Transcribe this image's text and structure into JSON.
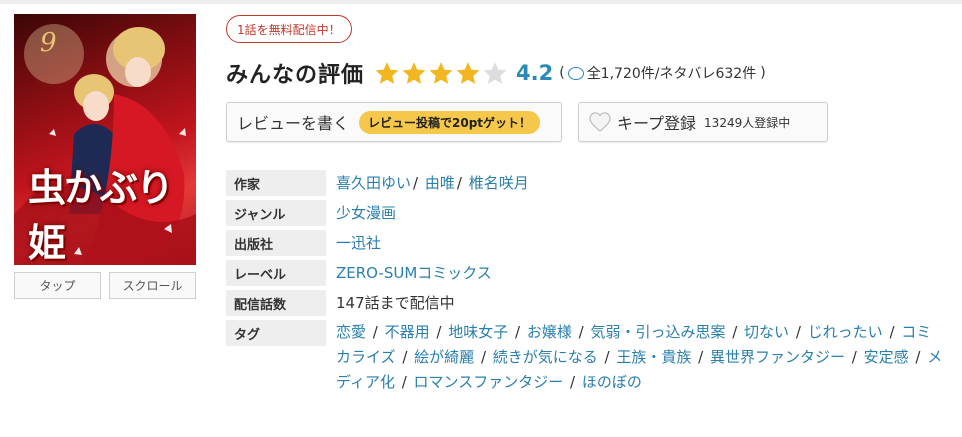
{
  "cover": {
    "title_text": "虫かぶり姫",
    "volume_mark": "9",
    "buttons": [
      {
        "label": "タップ"
      },
      {
        "label": "スクロール"
      }
    ]
  },
  "free_badge": "1話を無料配信中！",
  "rating": {
    "heading": "みんなの評価",
    "score": "4.2",
    "stars_filled": 4,
    "stars_total": 5,
    "counts_open": "(",
    "counts_text": "全1,720件/ネタバレ632件",
    "counts_close": ")"
  },
  "review_button": {
    "label": "レビューを書く",
    "bonus": "レビュー投稿で20ptゲット！"
  },
  "keep_button": {
    "label": "キープ登録",
    "count": "13249人登録中"
  },
  "info": {
    "author_key": "作家",
    "authors": [
      "喜久田ゆい",
      "由唯",
      "椎名咲月"
    ],
    "genre_key": "ジャンル",
    "genre": "少女漫画",
    "publisher_key": "出版社",
    "publisher": "一迅社",
    "label_key": "レーベル",
    "label": "ZERO-SUMコミックス",
    "episodes_key": "配信話数",
    "episodes": "147話まで配信中",
    "tags_key": "タグ",
    "tags": [
      "恋愛",
      "不器用",
      "地味女子",
      "お嬢様",
      "気弱・引っ込み思案",
      "切ない",
      "じれったい",
      "コミカライズ",
      "絵が綺麗",
      "続きが気になる",
      "王族・貴族",
      "異世界ファンタジー",
      "安定感",
      "メディア化",
      "ロマンスファンタジー",
      "ほのぼの"
    ]
  },
  "colors": {
    "link": "#2a7fad",
    "score": "#2a8ab5",
    "star": "#f2b720",
    "badge": "#c0392b",
    "bonus": "#f5c74a"
  }
}
